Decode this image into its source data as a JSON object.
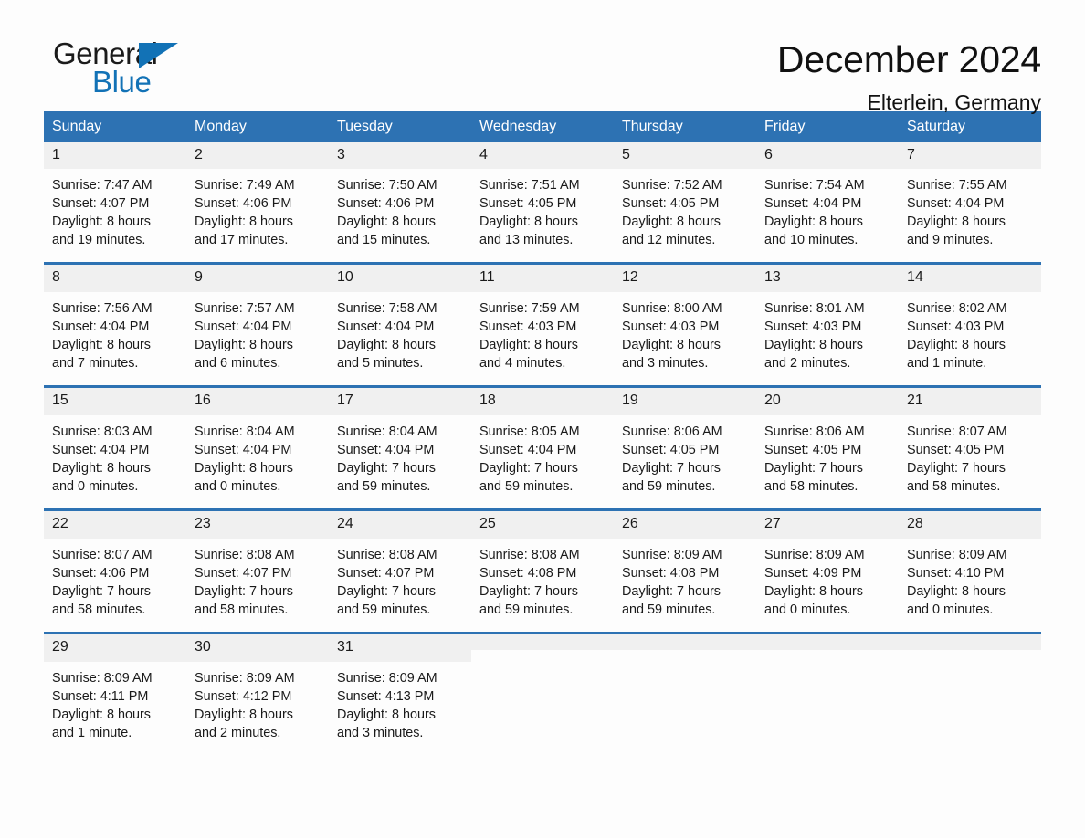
{
  "brand": {
    "name_part1": "General",
    "name_part2": "Blue",
    "triangle_icon": "triangle-icon",
    "color_black": "#1b1b1b",
    "color_blue": "#1272b6"
  },
  "header": {
    "month_title": "December 2024",
    "location": "Elterlein, Germany"
  },
  "theme": {
    "header_blue": "#2d72b3",
    "daynum_band": "#f0f0f0",
    "page_background": "#fdfdfd",
    "text": "#1a1a1a"
  },
  "weekdays": [
    "Sunday",
    "Monday",
    "Tuesday",
    "Wednesday",
    "Thursday",
    "Friday",
    "Saturday"
  ],
  "weeks": [
    [
      {
        "day": "1",
        "sunrise": "Sunrise: 7:47 AM",
        "sunset": "Sunset: 4:07 PM",
        "daylight_line1": "Daylight: 8 hours",
        "daylight_line2": "and 19 minutes."
      },
      {
        "day": "2",
        "sunrise": "Sunrise: 7:49 AM",
        "sunset": "Sunset: 4:06 PM",
        "daylight_line1": "Daylight: 8 hours",
        "daylight_line2": "and 17 minutes."
      },
      {
        "day": "3",
        "sunrise": "Sunrise: 7:50 AM",
        "sunset": "Sunset: 4:06 PM",
        "daylight_line1": "Daylight: 8 hours",
        "daylight_line2": "and 15 minutes."
      },
      {
        "day": "4",
        "sunrise": "Sunrise: 7:51 AM",
        "sunset": "Sunset: 4:05 PM",
        "daylight_line1": "Daylight: 8 hours",
        "daylight_line2": "and 13 minutes."
      },
      {
        "day": "5",
        "sunrise": "Sunrise: 7:52 AM",
        "sunset": "Sunset: 4:05 PM",
        "daylight_line1": "Daylight: 8 hours",
        "daylight_line2": "and 12 minutes."
      },
      {
        "day": "6",
        "sunrise": "Sunrise: 7:54 AM",
        "sunset": "Sunset: 4:04 PM",
        "daylight_line1": "Daylight: 8 hours",
        "daylight_line2": "and 10 minutes."
      },
      {
        "day": "7",
        "sunrise": "Sunrise: 7:55 AM",
        "sunset": "Sunset: 4:04 PM",
        "daylight_line1": "Daylight: 8 hours",
        "daylight_line2": "and 9 minutes."
      }
    ],
    [
      {
        "day": "8",
        "sunrise": "Sunrise: 7:56 AM",
        "sunset": "Sunset: 4:04 PM",
        "daylight_line1": "Daylight: 8 hours",
        "daylight_line2": "and 7 minutes."
      },
      {
        "day": "9",
        "sunrise": "Sunrise: 7:57 AM",
        "sunset": "Sunset: 4:04 PM",
        "daylight_line1": "Daylight: 8 hours",
        "daylight_line2": "and 6 minutes."
      },
      {
        "day": "10",
        "sunrise": "Sunrise: 7:58 AM",
        "sunset": "Sunset: 4:04 PM",
        "daylight_line1": "Daylight: 8 hours",
        "daylight_line2": "and 5 minutes."
      },
      {
        "day": "11",
        "sunrise": "Sunrise: 7:59 AM",
        "sunset": "Sunset: 4:03 PM",
        "daylight_line1": "Daylight: 8 hours",
        "daylight_line2": "and 4 minutes."
      },
      {
        "day": "12",
        "sunrise": "Sunrise: 8:00 AM",
        "sunset": "Sunset: 4:03 PM",
        "daylight_line1": "Daylight: 8 hours",
        "daylight_line2": "and 3 minutes."
      },
      {
        "day": "13",
        "sunrise": "Sunrise: 8:01 AM",
        "sunset": "Sunset: 4:03 PM",
        "daylight_line1": "Daylight: 8 hours",
        "daylight_line2": "and 2 minutes."
      },
      {
        "day": "14",
        "sunrise": "Sunrise: 8:02 AM",
        "sunset": "Sunset: 4:03 PM",
        "daylight_line1": "Daylight: 8 hours",
        "daylight_line2": "and 1 minute."
      }
    ],
    [
      {
        "day": "15",
        "sunrise": "Sunrise: 8:03 AM",
        "sunset": "Sunset: 4:04 PM",
        "daylight_line1": "Daylight: 8 hours",
        "daylight_line2": "and 0 minutes."
      },
      {
        "day": "16",
        "sunrise": "Sunrise: 8:04 AM",
        "sunset": "Sunset: 4:04 PM",
        "daylight_line1": "Daylight: 8 hours",
        "daylight_line2": "and 0 minutes."
      },
      {
        "day": "17",
        "sunrise": "Sunrise: 8:04 AM",
        "sunset": "Sunset: 4:04 PM",
        "daylight_line1": "Daylight: 7 hours",
        "daylight_line2": "and 59 minutes."
      },
      {
        "day": "18",
        "sunrise": "Sunrise: 8:05 AM",
        "sunset": "Sunset: 4:04 PM",
        "daylight_line1": "Daylight: 7 hours",
        "daylight_line2": "and 59 minutes."
      },
      {
        "day": "19",
        "sunrise": "Sunrise: 8:06 AM",
        "sunset": "Sunset: 4:05 PM",
        "daylight_line1": "Daylight: 7 hours",
        "daylight_line2": "and 59 minutes."
      },
      {
        "day": "20",
        "sunrise": "Sunrise: 8:06 AM",
        "sunset": "Sunset: 4:05 PM",
        "daylight_line1": "Daylight: 7 hours",
        "daylight_line2": "and 58 minutes."
      },
      {
        "day": "21",
        "sunrise": "Sunrise: 8:07 AM",
        "sunset": "Sunset: 4:05 PM",
        "daylight_line1": "Daylight: 7 hours",
        "daylight_line2": "and 58 minutes."
      }
    ],
    [
      {
        "day": "22",
        "sunrise": "Sunrise: 8:07 AM",
        "sunset": "Sunset: 4:06 PM",
        "daylight_line1": "Daylight: 7 hours",
        "daylight_line2": "and 58 minutes."
      },
      {
        "day": "23",
        "sunrise": "Sunrise: 8:08 AM",
        "sunset": "Sunset: 4:07 PM",
        "daylight_line1": "Daylight: 7 hours",
        "daylight_line2": "and 58 minutes."
      },
      {
        "day": "24",
        "sunrise": "Sunrise: 8:08 AM",
        "sunset": "Sunset: 4:07 PM",
        "daylight_line1": "Daylight: 7 hours",
        "daylight_line2": "and 59 minutes."
      },
      {
        "day": "25",
        "sunrise": "Sunrise: 8:08 AM",
        "sunset": "Sunset: 4:08 PM",
        "daylight_line1": "Daylight: 7 hours",
        "daylight_line2": "and 59 minutes."
      },
      {
        "day": "26",
        "sunrise": "Sunrise: 8:09 AM",
        "sunset": "Sunset: 4:08 PM",
        "daylight_line1": "Daylight: 7 hours",
        "daylight_line2": "and 59 minutes."
      },
      {
        "day": "27",
        "sunrise": "Sunrise: 8:09 AM",
        "sunset": "Sunset: 4:09 PM",
        "daylight_line1": "Daylight: 8 hours",
        "daylight_line2": "and 0 minutes."
      },
      {
        "day": "28",
        "sunrise": "Sunrise: 8:09 AM",
        "sunset": "Sunset: 4:10 PM",
        "daylight_line1": "Daylight: 8 hours",
        "daylight_line2": "and 0 minutes."
      }
    ],
    [
      {
        "day": "29",
        "sunrise": "Sunrise: 8:09 AM",
        "sunset": "Sunset: 4:11 PM",
        "daylight_line1": "Daylight: 8 hours",
        "daylight_line2": "and 1 minute."
      },
      {
        "day": "30",
        "sunrise": "Sunrise: 8:09 AM",
        "sunset": "Sunset: 4:12 PM",
        "daylight_line1": "Daylight: 8 hours",
        "daylight_line2": "and 2 minutes."
      },
      {
        "day": "31",
        "sunrise": "Sunrise: 8:09 AM",
        "sunset": "Sunset: 4:13 PM",
        "daylight_line1": "Daylight: 8 hours",
        "daylight_line2": "and 3 minutes."
      },
      {
        "day": "",
        "sunrise": "",
        "sunset": "",
        "daylight_line1": "",
        "daylight_line2": ""
      },
      {
        "day": "",
        "sunrise": "",
        "sunset": "",
        "daylight_line1": "",
        "daylight_line2": ""
      },
      {
        "day": "",
        "sunrise": "",
        "sunset": "",
        "daylight_line1": "",
        "daylight_line2": ""
      },
      {
        "day": "",
        "sunrise": "",
        "sunset": "",
        "daylight_line1": "",
        "daylight_line2": ""
      }
    ]
  ]
}
